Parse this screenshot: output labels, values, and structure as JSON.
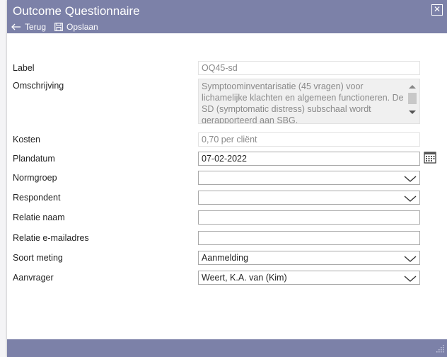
{
  "dialog": {
    "title": "Outcome Questionnaire",
    "back_label": "Terug",
    "save_label": "Opslaan"
  },
  "fields": {
    "label": {
      "label": "Label",
      "value": "OQ45-sd"
    },
    "omschrijving": {
      "label": "Omschrijving",
      "value": "Symptoominventarisatie (45 vragen) voor lichamelijke klachten en algemeen functioneren. De SD (symptomatic distress) subschaal wordt gerapporteerd aan SBG."
    },
    "kosten": {
      "label": "Kosten",
      "value": "0,70 per cliënt"
    },
    "plandatum": {
      "label": "Plandatum",
      "value": "07-02-2022"
    },
    "normgroep": {
      "label": "Normgroep",
      "value": ""
    },
    "respondent": {
      "label": "Respondent",
      "value": ""
    },
    "relatie_naam": {
      "label": "Relatie naam",
      "value": ""
    },
    "relatie_email": {
      "label": "Relatie e-mailadres",
      "value": ""
    },
    "soort_meting": {
      "label": "Soort meting",
      "value": "Aanmelding"
    },
    "aanvrager": {
      "label": "Aanvrager",
      "value": "Weert, K.A. van (Kim)"
    }
  },
  "colors": {
    "titlebar": "#7c81a8",
    "footer": "#7c81a8"
  },
  "icons": [
    "close-icon",
    "arrow-left-icon",
    "save-icon",
    "calendar-icon",
    "chevron-down-icon",
    "resize-grip-icon"
  ]
}
